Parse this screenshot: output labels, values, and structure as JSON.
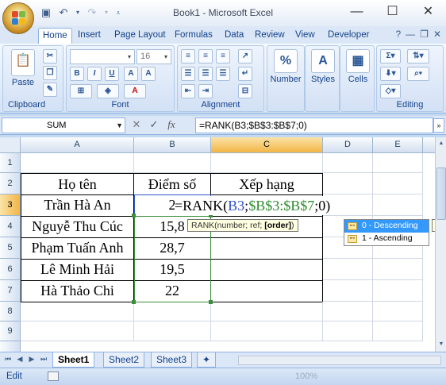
{
  "window": {
    "title": "Book1 - Microsoft Excel",
    "controls": [
      "—",
      "☐",
      "✕"
    ]
  },
  "ribbon": {
    "tabs": [
      "Home",
      "Insert",
      "Page Layout",
      "Formulas",
      "Data",
      "Review",
      "View",
      "Developer"
    ],
    "active_tab": "Home",
    "font_size": "16",
    "groups": {
      "clipboard": "Clipboard",
      "font": "Font",
      "alignment": "Alignment",
      "number": "Number",
      "styles": "Styles",
      "cells": "Cells",
      "editing": "Editing"
    },
    "paste_label": "Paste",
    "number_label": "Number",
    "styles_label": "Styles",
    "cells_label": "Cells",
    "bold": "B",
    "italic": "I",
    "underline": "U",
    "percent": "%"
  },
  "formula_bar": {
    "name_box": "SUM",
    "fx": "fx",
    "formula": "=RANK(B3;$B$3:$B$7;0)"
  },
  "columns": [
    "A",
    "B",
    "C",
    "D",
    "E"
  ],
  "rows": [
    "1",
    "2",
    "3",
    "4",
    "5",
    "6",
    "7",
    "8",
    "9"
  ],
  "cells": {
    "A2": "Họ tên",
    "B2": "Điểm số",
    "C2": "Xếp hạng",
    "A3": "Trần Hà An",
    "B3": "2",
    "A4": "Nguyễ Thu Cúc",
    "B4": "15,8",
    "A5": "Phạm Tuấn Anh",
    "B5": "28,7",
    "A6": "Lê Minh Hải",
    "B6": "19,5",
    "A7": "Hà Thảo Chi",
    "B7": "22"
  },
  "editor": {
    "prefix": "=RANK(",
    "ref1": "B3",
    "sep1": ";",
    "ref2": "$B$3:$B$7",
    "rest": ";0)",
    "ref1_color": "#2e4fd0",
    "ref2_color": "#2e8b2e"
  },
  "tooltip": {
    "func": "RANK(number; ref; ",
    "current_arg": "[order]",
    "close": ")"
  },
  "autocomplete": [
    {
      "label": "0 - Descending",
      "active": true
    },
    {
      "label": "1 - Ascending",
      "active": false
    }
  ],
  "ac_tip": "Ra",
  "sheets": [
    "Sheet1",
    "Sheet2",
    "Sheet3"
  ],
  "active_sheet": "Sheet1",
  "status": {
    "mode": "Edit",
    "zoom": "100%"
  }
}
